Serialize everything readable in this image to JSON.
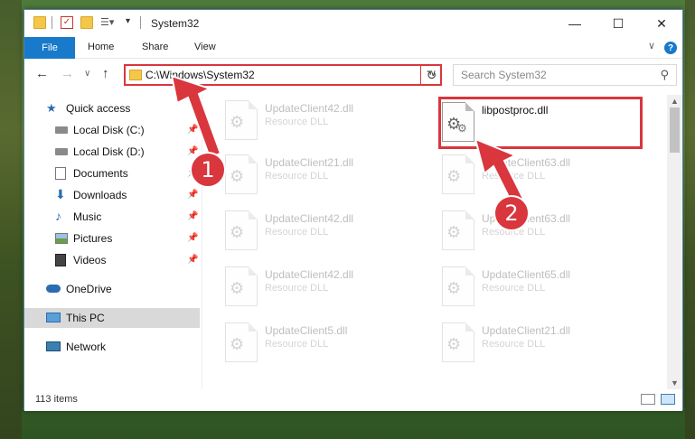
{
  "titlebar": {
    "title": "System32",
    "minimize_glyph": "—",
    "maximize_glyph": "☐",
    "close_glyph": "✕"
  },
  "ribbon": {
    "tabs": [
      "File",
      "Home",
      "Share",
      "View"
    ],
    "help_glyph": "?",
    "collapse_glyph": "∨"
  },
  "navigation": {
    "back_glyph": "←",
    "forward_glyph": "→",
    "recent_glyph": "∨",
    "up_glyph": "↑",
    "address": "C:\\Windows\\System32",
    "address_dropdown_glyph": "∨",
    "refresh_glyph": "↻",
    "search_placeholder": "Search System32",
    "search_glyph": "⚲"
  },
  "sidebar": {
    "items": [
      {
        "label": "Quick access",
        "icon": "star-icon",
        "pinned": false
      },
      {
        "label": "Local Disk (C:)",
        "icon": "drive-icon",
        "pinned": true
      },
      {
        "label": "Local Disk (D:)",
        "icon": "drive-icon",
        "pinned": true
      },
      {
        "label": "Documents",
        "icon": "documents-icon",
        "pinned": true
      },
      {
        "label": "Downloads",
        "icon": "download-icon",
        "pinned": true
      },
      {
        "label": "Music",
        "icon": "music-icon",
        "pinned": true
      },
      {
        "label": "Pictures",
        "icon": "pictures-icon",
        "pinned": true
      },
      {
        "label": "Videos",
        "icon": "videos-icon",
        "pinned": true
      },
      {
        "label": "OneDrive",
        "icon": "cloud-icon",
        "pinned": false
      },
      {
        "label": "This PC",
        "icon": "computer-icon",
        "pinned": false,
        "selected": true
      },
      {
        "label": "Network",
        "icon": "network-icon",
        "pinned": false
      }
    ],
    "pin_glyph": "📌"
  },
  "files": [
    {
      "name": "UpdateClient42.dll",
      "type": "Resource DLL"
    },
    {
      "name": "libpostproc.dll",
      "type": ""
    },
    {
      "name": "UpdateClient21.dll",
      "type": "Resource DLL"
    },
    {
      "name": "UpdateClient63.dll",
      "type": "Resource DLL"
    },
    {
      "name": "UpdateClient42.dll",
      "type": "Resource DLL"
    },
    {
      "name": "UpdateClient63.dll",
      "type": "Resource DLL"
    },
    {
      "name": "UpdateClient42.dll",
      "type": "Resource DLL"
    },
    {
      "name": "UpdateClient65.dll",
      "type": "Resource DLL"
    },
    {
      "name": "UpdateClient5.dll",
      "type": "Resource DLL"
    },
    {
      "name": "UpdateClient21.dll",
      "type": "Resource DLL"
    }
  ],
  "status": {
    "item_count": "113 items"
  },
  "annotations": {
    "marker1": "1",
    "marker2": "2"
  },
  "colors": {
    "accent": "#1979ca",
    "highlight": "#d9363e"
  }
}
